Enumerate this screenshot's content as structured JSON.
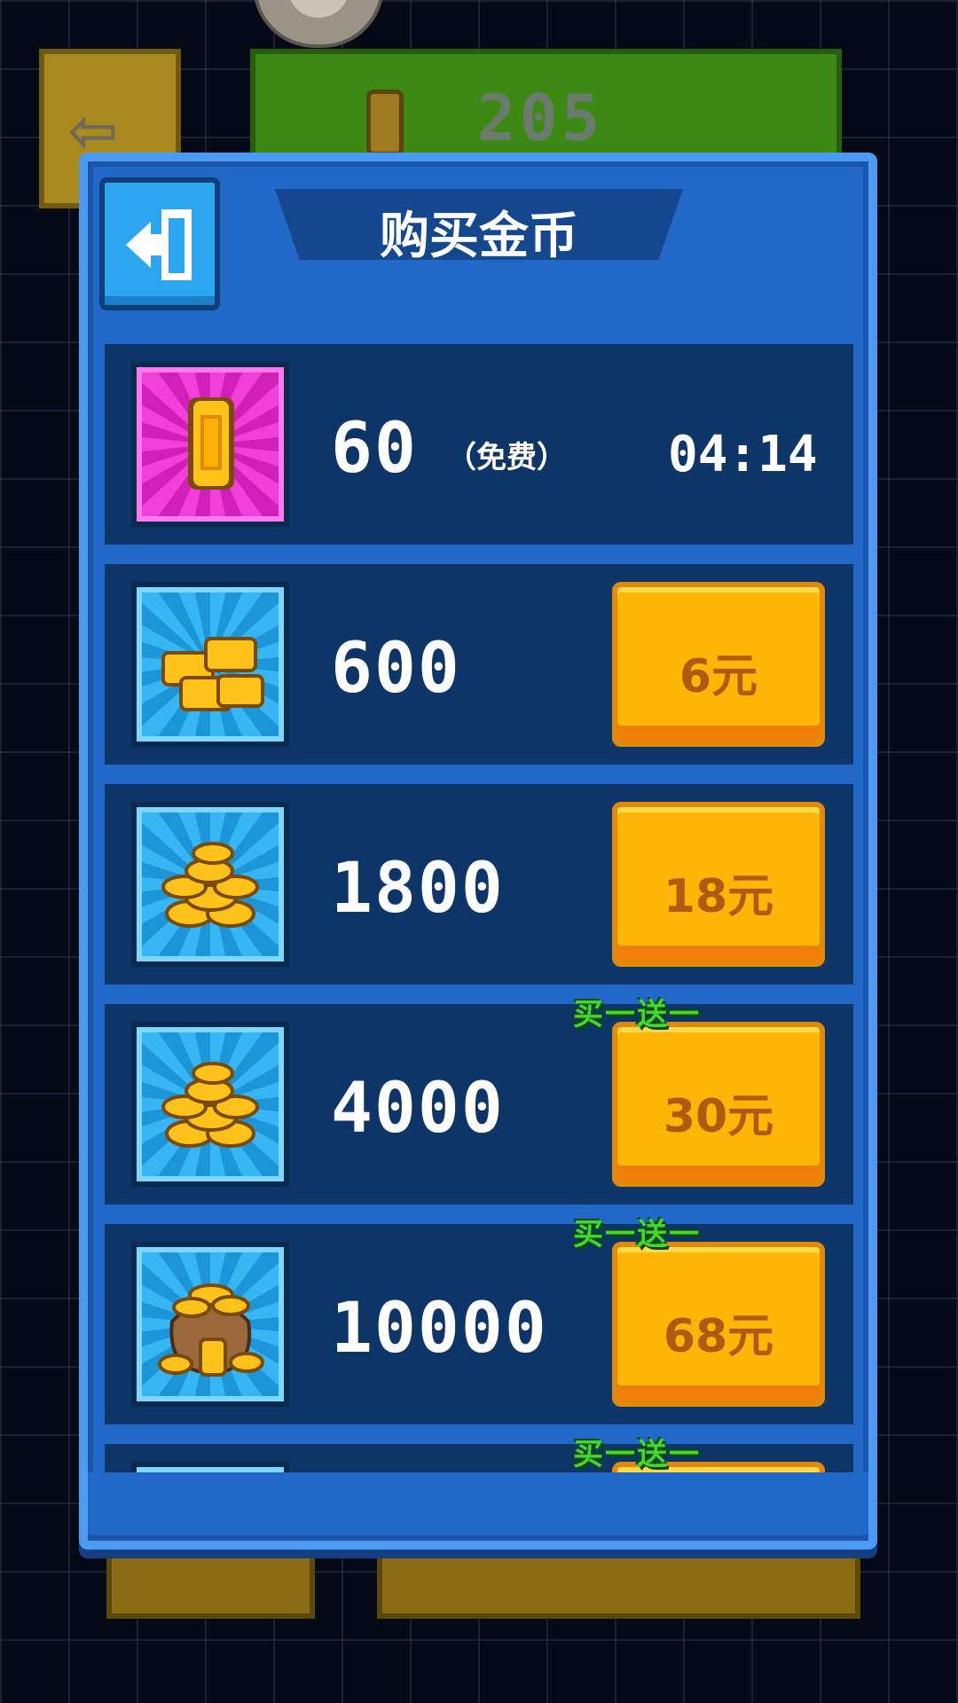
{
  "background": {
    "coin_count": "205"
  },
  "dialog": {
    "title": "购买金币",
    "exit_icon": "exit-door-icon"
  },
  "items": [
    {
      "amount": "60",
      "free_label": "（免费）",
      "timer": "04:14",
      "icon": "single-gold-coin-icon",
      "theme": "pink"
    },
    {
      "amount": "600",
      "price": "6元",
      "icon": "gold-bars-icon",
      "theme": "cyan"
    },
    {
      "amount": "1800",
      "price": "18元",
      "icon": "gold-coin-pile-icon",
      "theme": "cyan"
    },
    {
      "amount": "4000",
      "price": "30元",
      "tag": "买一送一",
      "icon": "gold-coin-pile-icon",
      "theme": "cyan"
    },
    {
      "amount": "10000",
      "price": "68元",
      "tag": "买一送一",
      "icon": "gold-coin-sack-icon",
      "theme": "cyan"
    },
    {
      "tag": "买一送一",
      "icon": "gold-coin-icon",
      "theme": "cyan"
    }
  ],
  "colors": {
    "panel": "#2168c8",
    "row": "#0e3568",
    "button": "#ffb607",
    "tag": "#42d830"
  }
}
